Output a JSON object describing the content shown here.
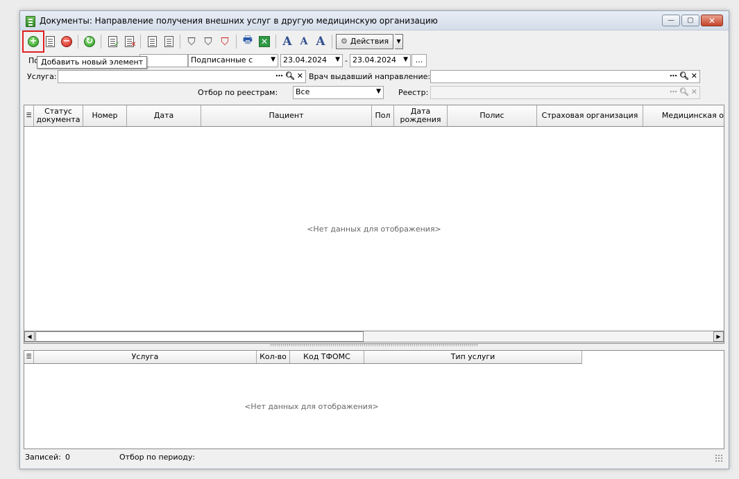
{
  "window": {
    "title": "Документы: Направление получения внешних услуг в другую медицинскую организацию",
    "buttons": {
      "minimize": "—",
      "maximize": "▢",
      "close": "✕"
    }
  },
  "toolbar": {
    "buttons": [
      {
        "name": "add",
        "icon": "plus-circle-green-icon"
      },
      {
        "name": "edit",
        "icon": "document-edit-icon"
      },
      {
        "name": "delete",
        "icon": "minus-circle-red-icon"
      },
      {
        "name": "refresh",
        "icon": "refresh-green-icon"
      },
      {
        "name": "sign",
        "icon": "document-check-icon"
      },
      {
        "name": "unsign",
        "icon": "document-cross-icon"
      },
      {
        "name": "copy",
        "icon": "copy-documents-icon"
      },
      {
        "name": "paste",
        "icon": "paste-documents-icon"
      },
      {
        "name": "filter",
        "icon": "funnel-icon"
      },
      {
        "name": "filter-edit",
        "icon": "funnel-edit-icon"
      },
      {
        "name": "filter-clear",
        "icon": "funnel-clear-icon"
      },
      {
        "name": "print",
        "icon": "printer-icon"
      },
      {
        "name": "excel",
        "icon": "excel-export-icon"
      },
      {
        "name": "font-increase",
        "icon": "font-increase-icon"
      },
      {
        "name": "font-decrease",
        "icon": "font-decrease-icon"
      },
      {
        "name": "font-default",
        "icon": "font-default-icon"
      }
    ],
    "actions_label": "Действия"
  },
  "tooltip": "Добавить новый элемент",
  "filters": {
    "period_label_prefix": "По",
    "status_select": "Подписанные с",
    "date_from": "23.04.2024",
    "date_separator": "-",
    "date_to": "23.04.2024",
    "ellipsis": "...",
    "service_label": "Услуга:",
    "service_value": "",
    "doctor_label": "Врач выдавший направление:",
    "doctor_value": "",
    "registry_filter_label": "Отбор по реестрам:",
    "registry_filter_value": "Все",
    "registry_label": "Реестр:",
    "registry_value": ""
  },
  "main_grid": {
    "columns": [
      "Статус документа",
      "Номер",
      "Дата",
      "Пациент",
      "Пол",
      "Дата рождения",
      "Полис",
      "Страховая организация",
      "Медицинская о"
    ],
    "empty_text": "<Нет данных для отображения>"
  },
  "detail_grid": {
    "columns": [
      "Услуга",
      "Кол-во",
      "Код ТФОМС",
      "Тип услуги"
    ],
    "empty_text": "<Нет данных для отображения>"
  },
  "status": {
    "records_label": "Записей:",
    "records_count": "0",
    "period_filter_label": "Отбор по периоду:"
  }
}
